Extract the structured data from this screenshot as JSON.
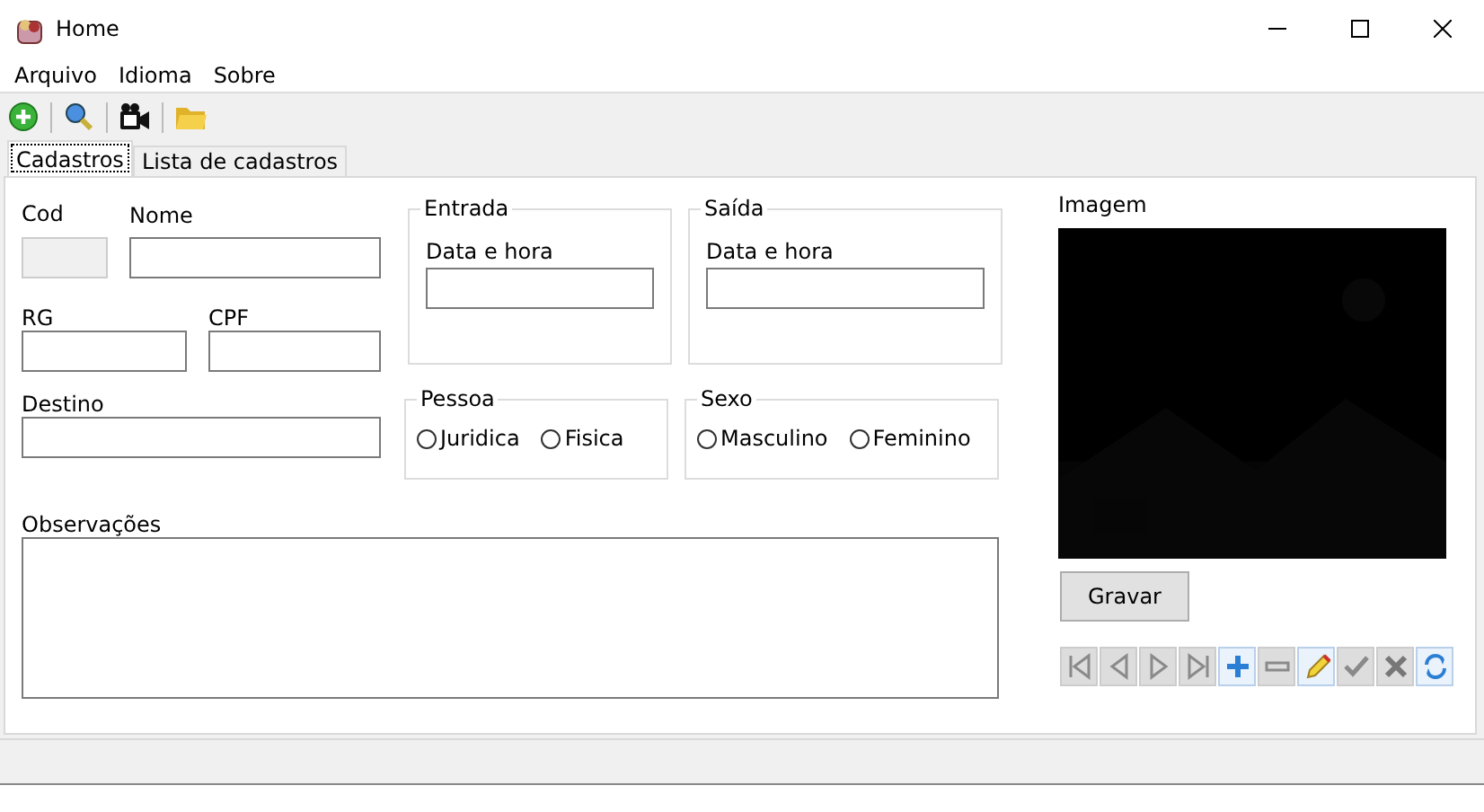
{
  "window": {
    "title": "Home"
  },
  "menu": [
    "Arquivo",
    "Idioma",
    "Sobre"
  ],
  "toolbar": [
    {
      "kind": "add"
    },
    {
      "kind": "search"
    },
    {
      "kind": "camera"
    },
    {
      "kind": "folder"
    }
  ],
  "tabs": [
    {
      "label": "Cadastros",
      "selected": true
    },
    {
      "label": "Lista de cadastros",
      "selected": false
    }
  ],
  "form": {
    "cod": {
      "label": "Cod",
      "disabled": true
    },
    "nome": {
      "label": "Nome"
    },
    "rg": {
      "label": "RG"
    },
    "cpf": {
      "label": "CPF"
    },
    "destino": {
      "label": "Destino"
    },
    "observacoes": {
      "label": "Observações"
    },
    "entrada": {
      "title": "Entrada",
      "label": "Data e hora"
    },
    "saida": {
      "title": "Saída",
      "label": "Data e hora"
    },
    "pessoa": {
      "title": "Pessoa",
      "options": [
        {
          "label": "Juridica",
          "selected": false
        },
        {
          "label": "Fisica",
          "selected": false
        }
      ]
    },
    "sexo": {
      "title": "Sexo",
      "options": [
        {
          "label": "Masculino",
          "selected": false
        },
        {
          "label": "Feminino",
          "selected": false
        }
      ]
    }
  },
  "image": {
    "label": "Imagem",
    "button": "Gravar"
  },
  "navigator": [
    {
      "kind": "first",
      "disabled": true
    },
    {
      "kind": "prev",
      "disabled": true
    },
    {
      "kind": "next",
      "disabled": true
    },
    {
      "kind": "last",
      "disabled": true
    },
    {
      "kind": "add",
      "disabled": false
    },
    {
      "kind": "remove",
      "disabled": true
    },
    {
      "kind": "edit",
      "disabled": false
    },
    {
      "kind": "confirm",
      "disabled": true
    },
    {
      "kind": "cancel",
      "disabled": true
    },
    {
      "kind": "refresh",
      "disabled": false
    }
  ]
}
